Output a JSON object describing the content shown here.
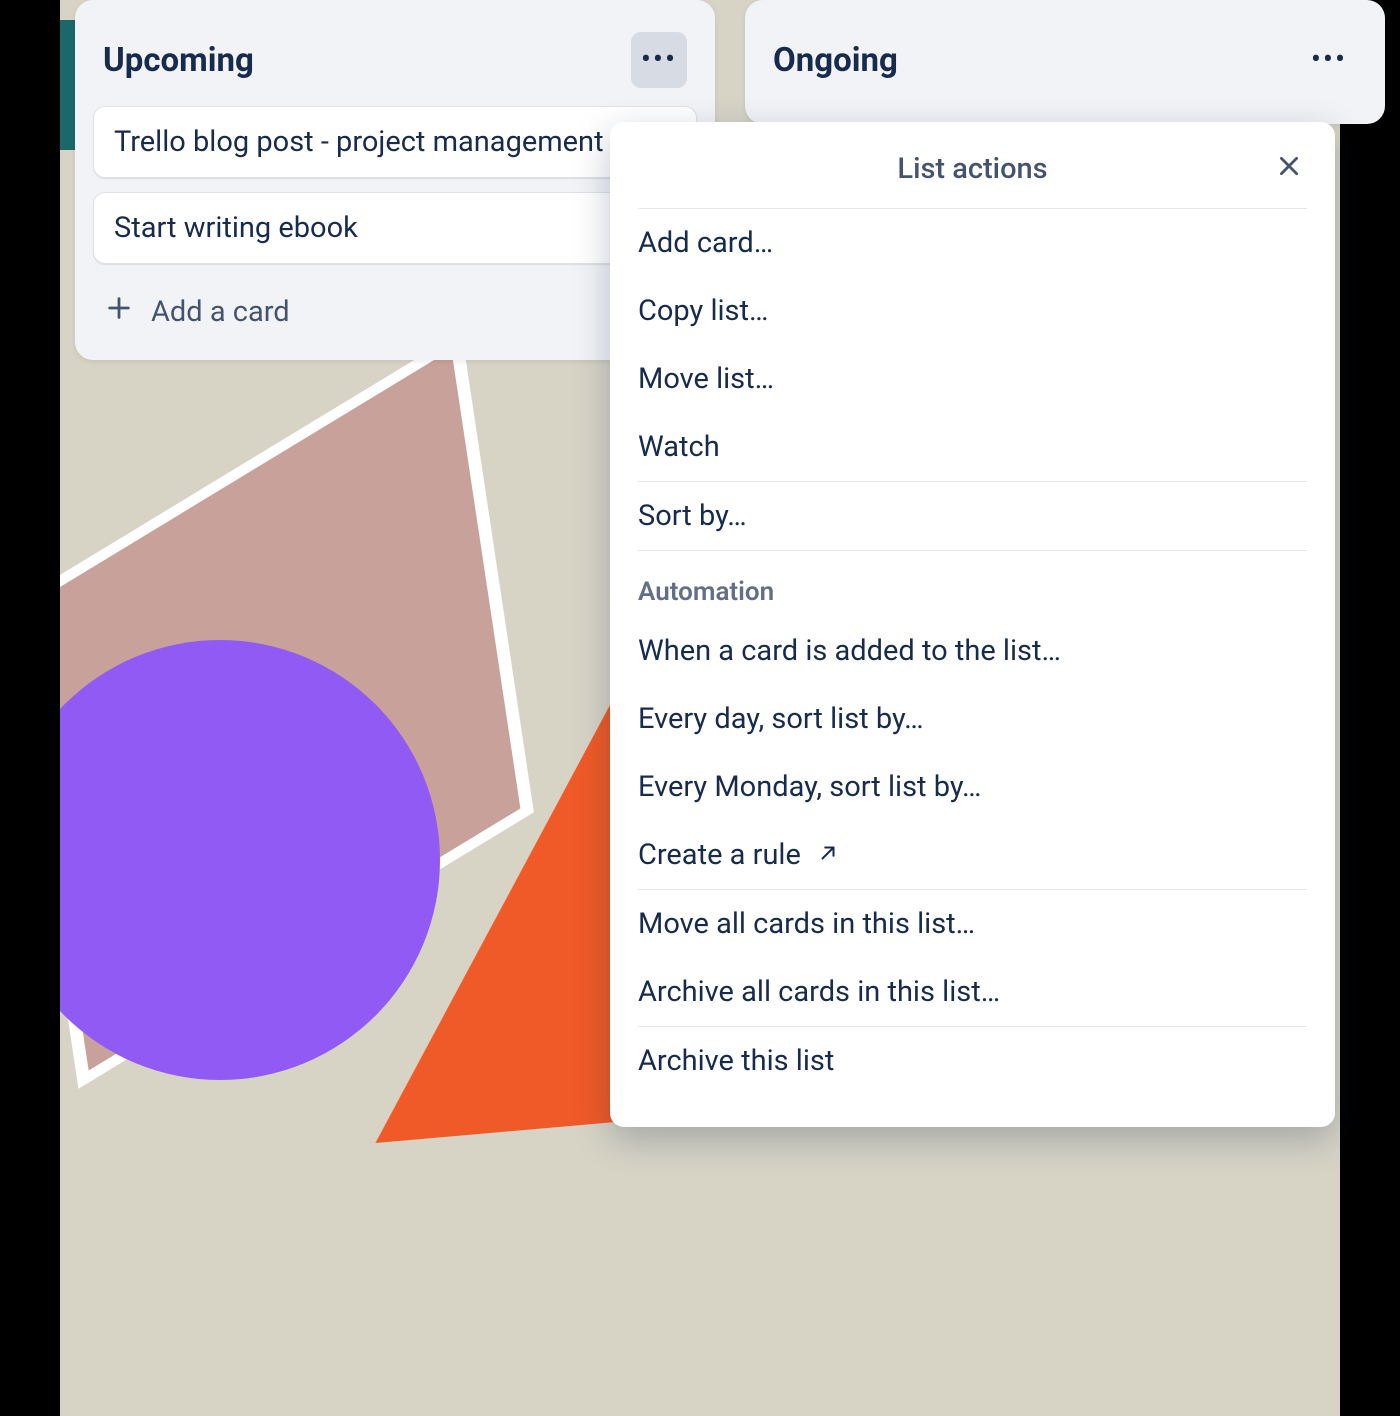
{
  "lists": {
    "upcoming": {
      "title": "Upcoming",
      "cards": [
        "Trello blog post - project management",
        "Start writing ebook"
      ],
      "add_card_label": "Add a card"
    },
    "ongoing": {
      "title": "Ongoing"
    }
  },
  "popover": {
    "title": "List actions",
    "group1": [
      "Add card…",
      "Copy list…",
      "Move list…",
      "Watch"
    ],
    "group2": [
      "Sort by…"
    ],
    "automation_label": "Automation",
    "automation_items": [
      "When a card is added to the list…",
      "Every day, sort list by…",
      "Every Monday, sort list by…"
    ],
    "create_rule": "Create a rule",
    "group4": [
      "Move all cards in this list…",
      "Archive all cards in this list…"
    ],
    "group5": [
      "Archive this list"
    ]
  }
}
